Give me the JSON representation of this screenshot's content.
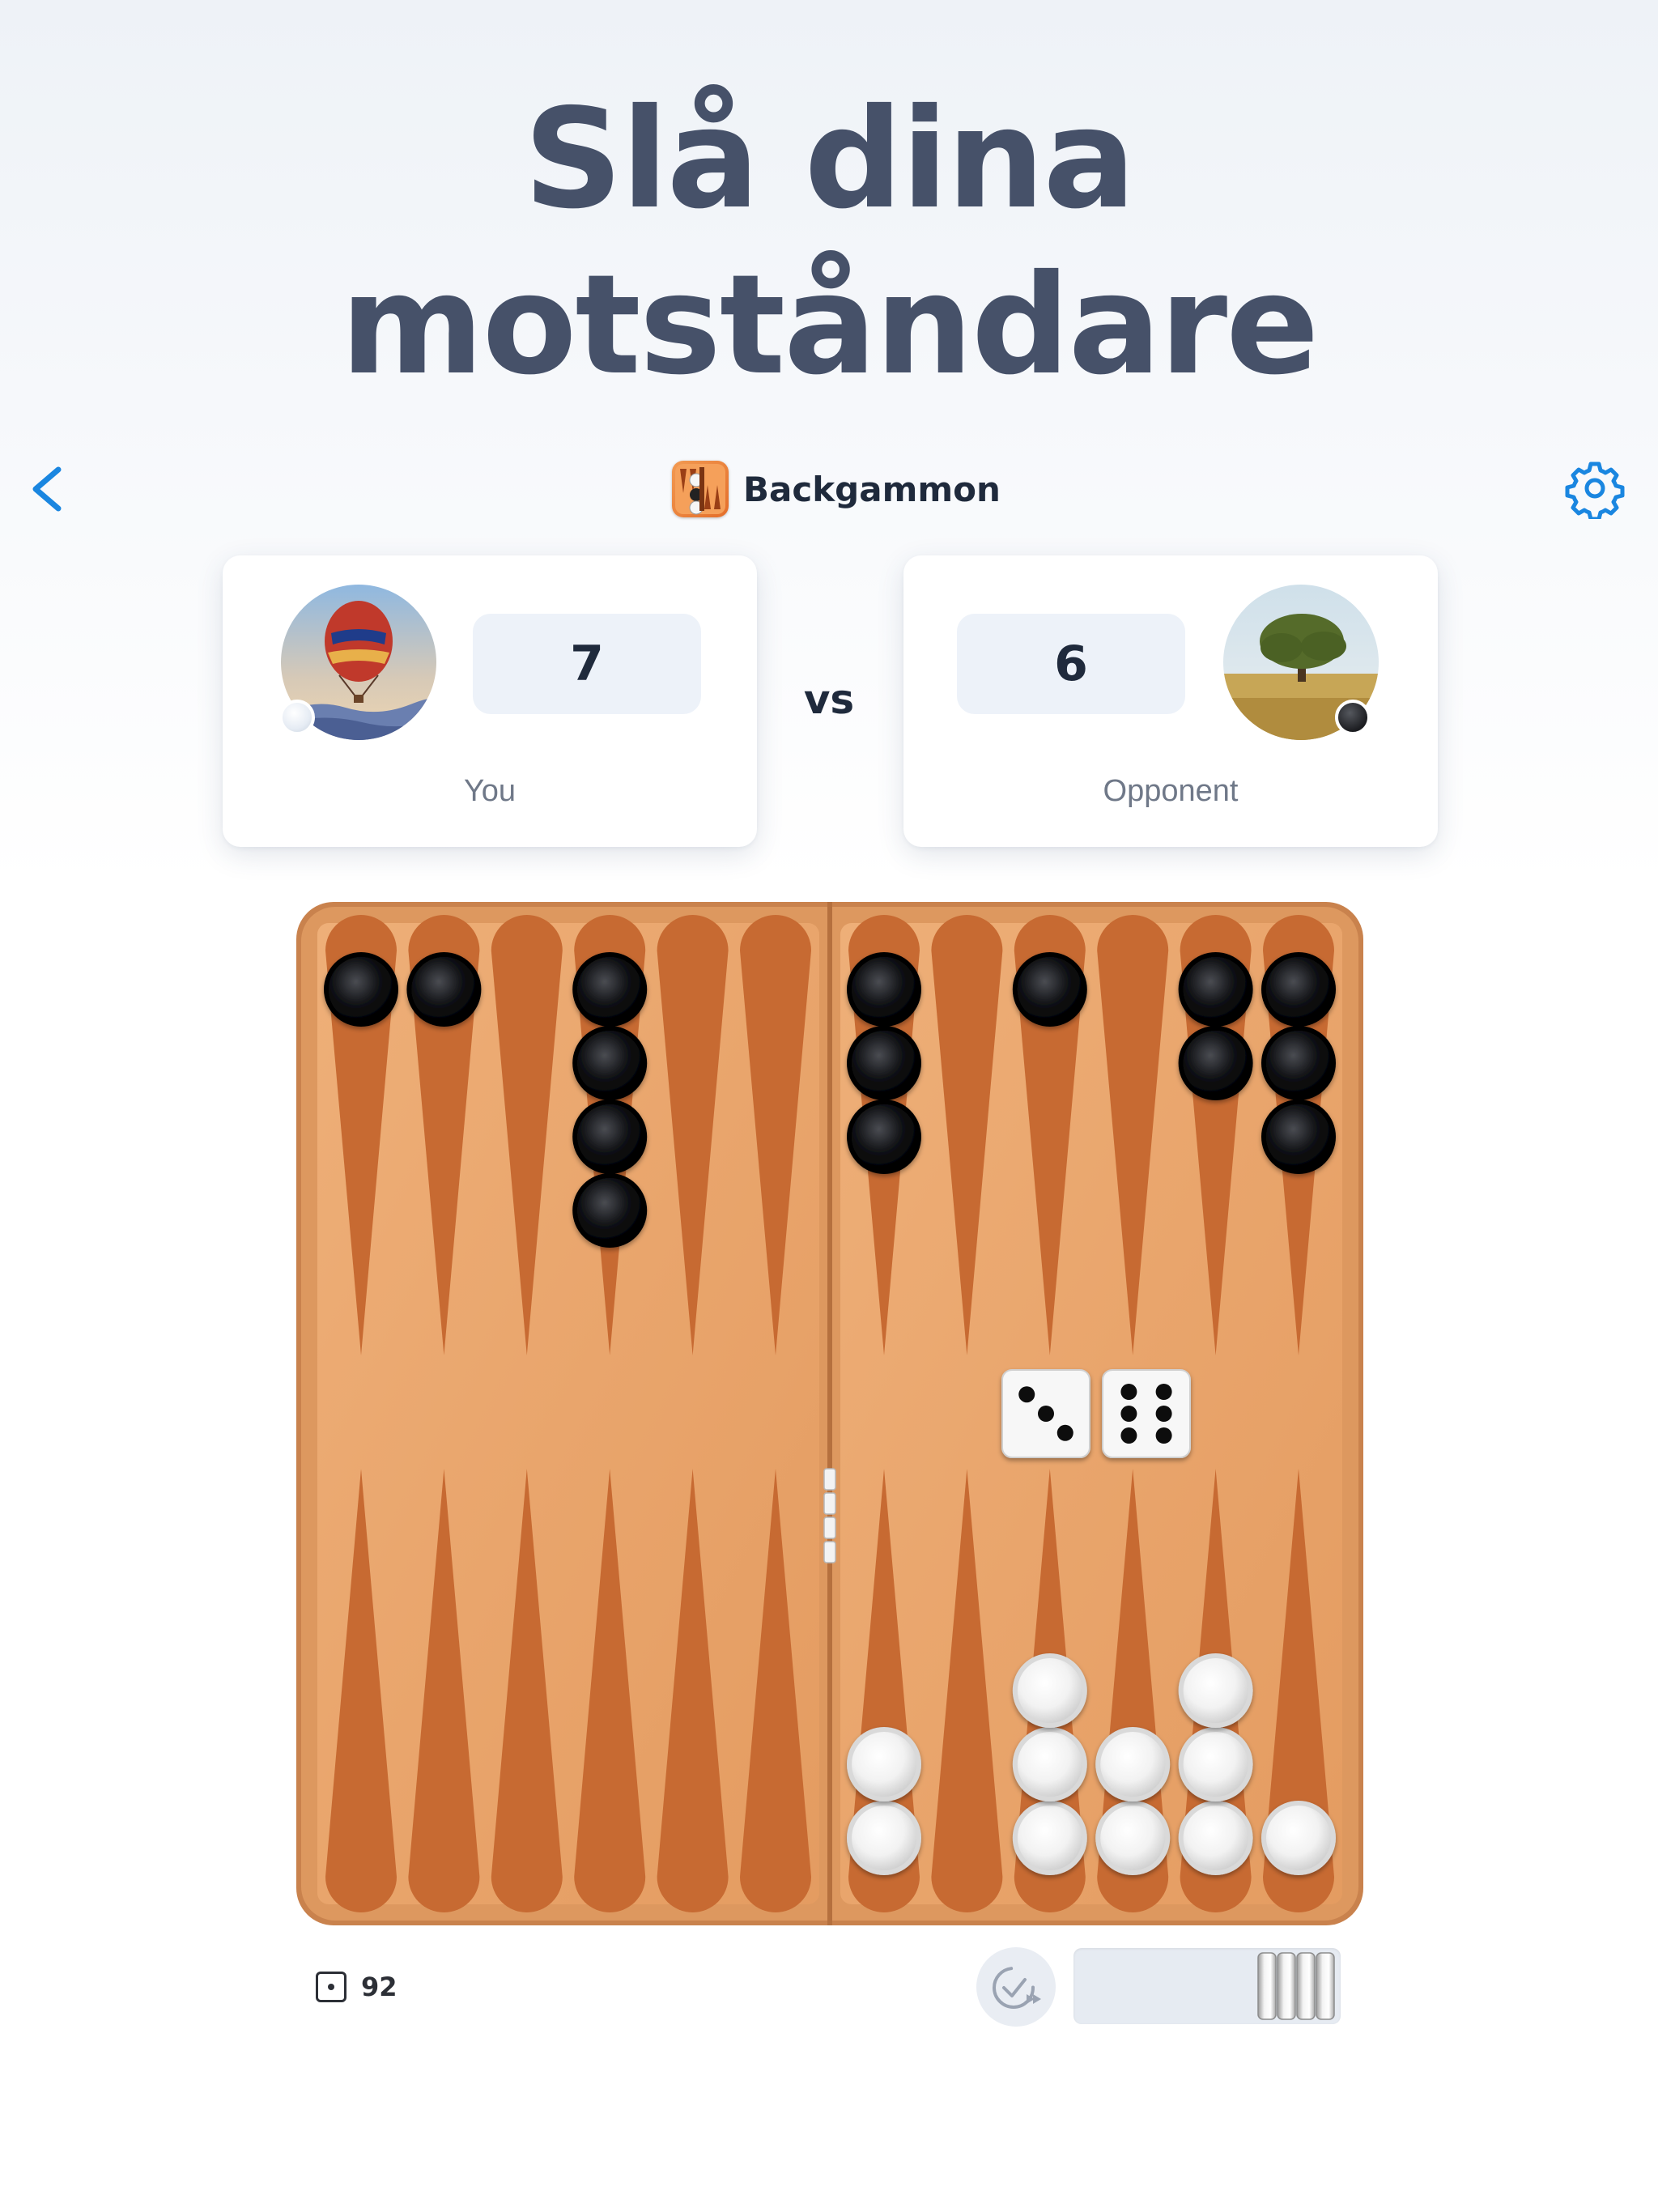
{
  "headline": {
    "line1": "Slå dina",
    "line2": "motståndare"
  },
  "nav": {
    "title": "Backgammon",
    "back_icon": "chevron-left-icon",
    "settings_icon": "gear-icon",
    "accent": "#1a86e0"
  },
  "players": {
    "you": {
      "label": "You",
      "score": "7",
      "piece_color": "white",
      "avatar": "hot-air-balloon"
    },
    "opponent": {
      "label": "Opponent",
      "score": "6",
      "piece_color": "black",
      "avatar": "tree-field"
    }
  },
  "vs_label": "vs",
  "board": {
    "colors": {
      "wood": "#e9a56d",
      "frame": "#d9925c",
      "point": "#c76a32"
    },
    "top_points": [
      {
        "count": 1,
        "color": "black"
      },
      {
        "count": 1,
        "color": "black"
      },
      {
        "count": 0,
        "color": "black"
      },
      {
        "count": 4,
        "color": "black"
      },
      {
        "count": 0,
        "color": "black"
      },
      {
        "count": 0,
        "color": "black"
      },
      {
        "count": 3,
        "color": "black"
      },
      {
        "count": 0,
        "color": "black"
      },
      {
        "count": 1,
        "color": "black"
      },
      {
        "count": 0,
        "color": "black"
      },
      {
        "count": 2,
        "color": "black"
      },
      {
        "count": 3,
        "color": "black"
      }
    ],
    "bottom_points": [
      {
        "count": 0,
        "color": "white"
      },
      {
        "count": 0,
        "color": "white"
      },
      {
        "count": 0,
        "color": "white"
      },
      {
        "count": 0,
        "color": "white"
      },
      {
        "count": 0,
        "color": "white"
      },
      {
        "count": 0,
        "color": "white"
      },
      {
        "count": 2,
        "color": "white"
      },
      {
        "count": 0,
        "color": "white"
      },
      {
        "count": 3,
        "color": "white"
      },
      {
        "count": 2,
        "color": "white"
      },
      {
        "count": 3,
        "color": "white"
      },
      {
        "count": 1,
        "color": "white"
      }
    ],
    "dice": [
      3,
      6
    ]
  },
  "footer": {
    "moves_icon": "die-icon",
    "moves_count": "92",
    "autoplay_icon": "autoplay-check-icon",
    "borne_off": 4
  }
}
